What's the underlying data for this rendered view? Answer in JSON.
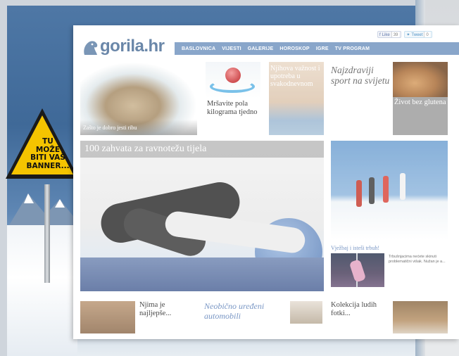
{
  "sign": {
    "lines": [
      "TU",
      "MOŽE",
      "BITI VAŠ",
      "BANNER..."
    ]
  },
  "site": {
    "logo_text": "gorila.hr",
    "social": {
      "like_label": "Like",
      "like_count": "39",
      "tweet_label": "Tweet",
      "tweet_count": "0"
    },
    "nav": [
      "BASLOVNICA",
      "VIJESTI",
      "GALERIJE",
      "HOROSKOP",
      "IGRE",
      "TV PROGRAM"
    ],
    "tiles": {
      "fish_caption": "Zašto je dobro jesti ribu",
      "apple_caption": "Mršavite pola kilograma tjedno",
      "belly_caption": "Njihova važnost i upotreba u svakodnevnom",
      "sport_caption": "Najzdraviji sport na svijetu",
      "bread_caption": "Život bez glutena",
      "yoga_title": "100 zahvata za ravnotežu tijela",
      "pole_link": "Vježbaj i isteši trbuh!",
      "pole_text": "Trbušnjacima nećete skinuti problematični višak. Nužan je a...",
      "cats_caption": "Njima je najljepše...",
      "cars_caption": "Neobično uređeni automobili",
      "fotki_caption": "Kolekcija ludih fotki..."
    }
  },
  "colors": {
    "nav": "#6f93bf",
    "logo": "#4a6d96",
    "sign_yellow": "#f5c400"
  }
}
